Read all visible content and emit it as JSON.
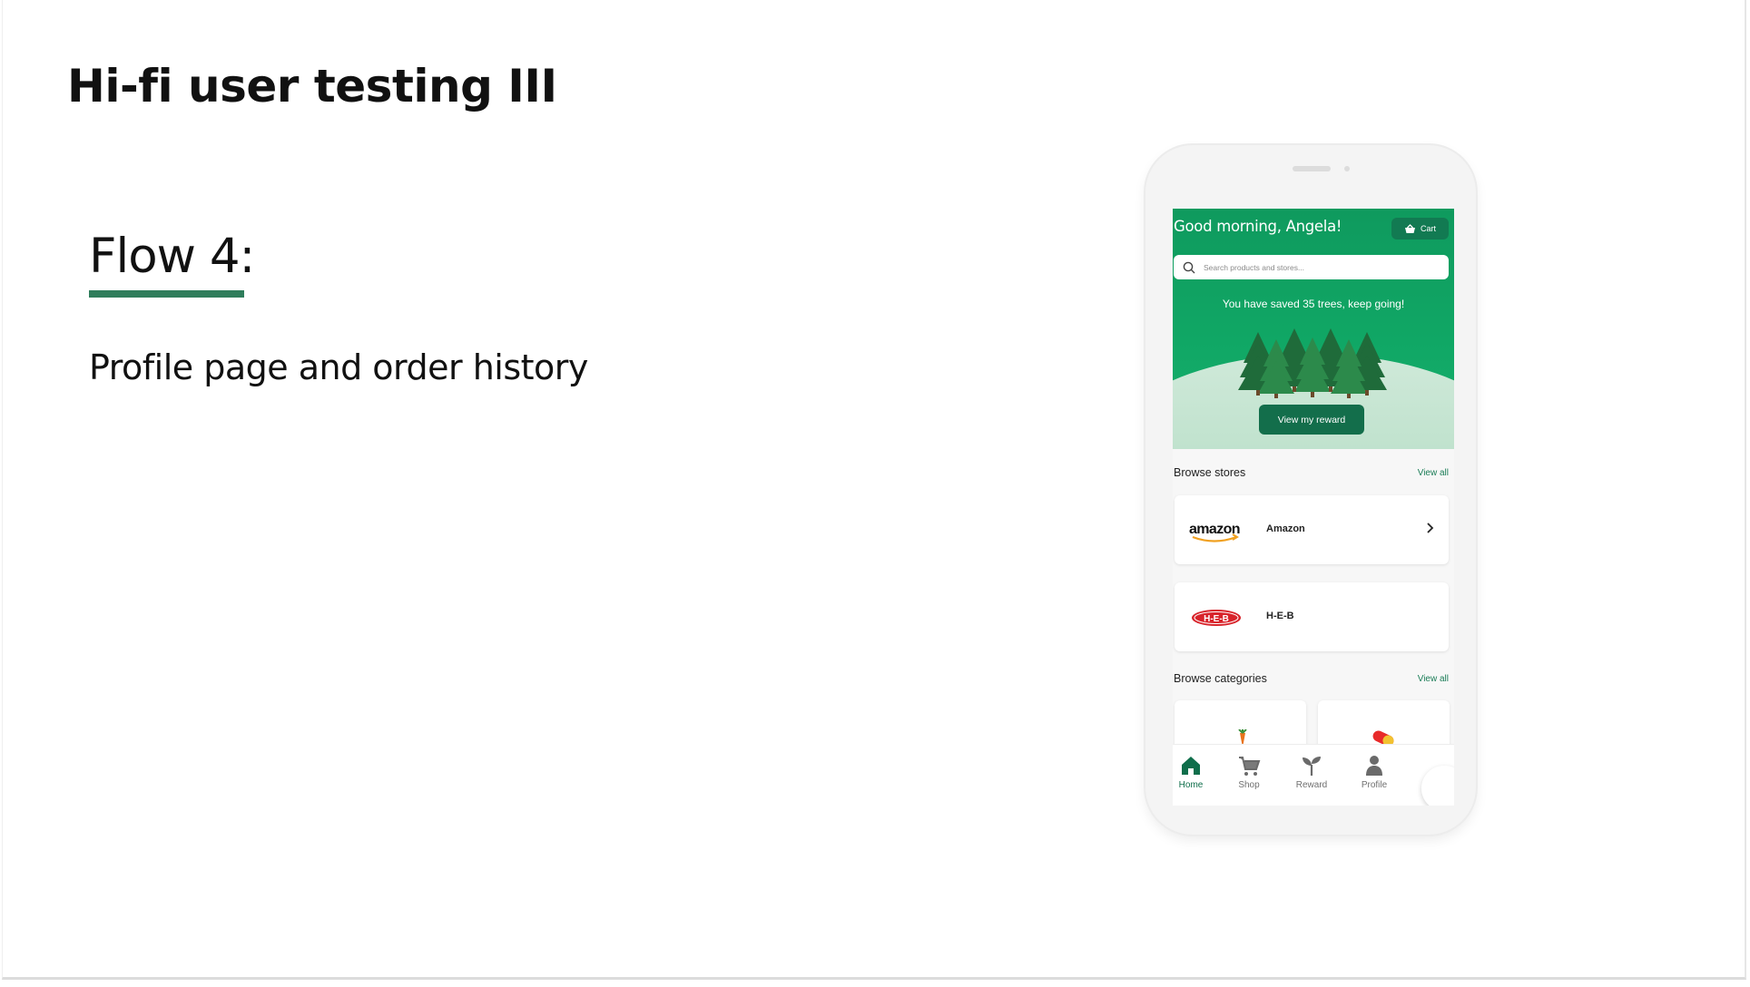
{
  "slide": {
    "title": "Hi-fi user testing III",
    "flow_heading": "Flow 4:",
    "flow_description": "Profile page and order history",
    "accent_color": "#2e7d5b"
  },
  "app": {
    "greeting": "Good morning, Angela!",
    "cart_label": "Cart",
    "search_placeholder": "Search products and stores...",
    "saved_message": "You have saved 35 trees, keep going!",
    "reward_button": "View my reward",
    "browse_stores": {
      "title": "Browse stores",
      "view_all": "View all",
      "stores": [
        {
          "name": "Amazon",
          "logo": "amazon-logo"
        },
        {
          "name": "H-E-B",
          "logo": "heb-logo"
        }
      ]
    },
    "browse_categories": {
      "title": "Browse categories",
      "view_all": "View all"
    },
    "tabs": [
      {
        "label": "Home",
        "icon": "home-icon",
        "active": true
      },
      {
        "label": "Shop",
        "icon": "cart-icon",
        "active": false
      },
      {
        "label": "Reward",
        "icon": "sprout-icon",
        "active": false
      },
      {
        "label": "Profile",
        "icon": "person-icon",
        "active": false
      }
    ],
    "brand_color": "#10a765"
  }
}
